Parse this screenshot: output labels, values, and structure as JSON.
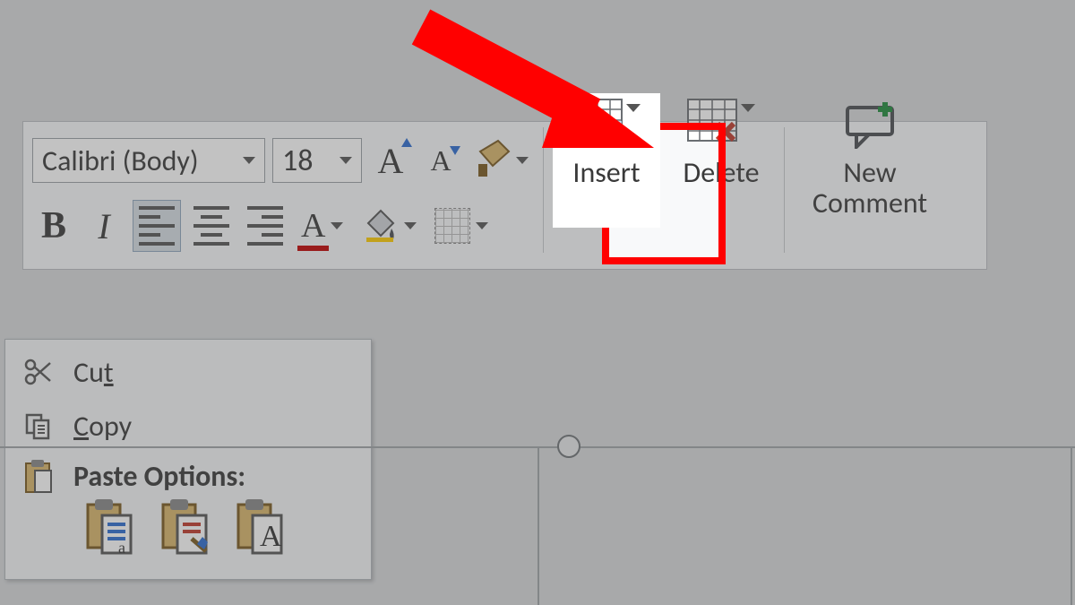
{
  "toolbar": {
    "font_name": "Calibri (Body)",
    "font_size": "18",
    "grow_font_label": "A",
    "shrink_font_label": "A",
    "bold_label": "B",
    "italic_label": "I",
    "font_color_letter": "A",
    "highlight_letter": "A",
    "insert": {
      "label": "Insert"
    },
    "delete": {
      "label": "Delete"
    },
    "new_comment": {
      "line1": "New",
      "line2": "Comment"
    }
  },
  "context_menu": {
    "cut": "Cut",
    "copy": "Copy",
    "paste_header": "Paste Options:"
  },
  "colors": {
    "highlight_border": "#ff0000",
    "arrow": "#ff0000",
    "font_color_bar": "#c00000",
    "highlight_bar": "#ffcc00"
  }
}
